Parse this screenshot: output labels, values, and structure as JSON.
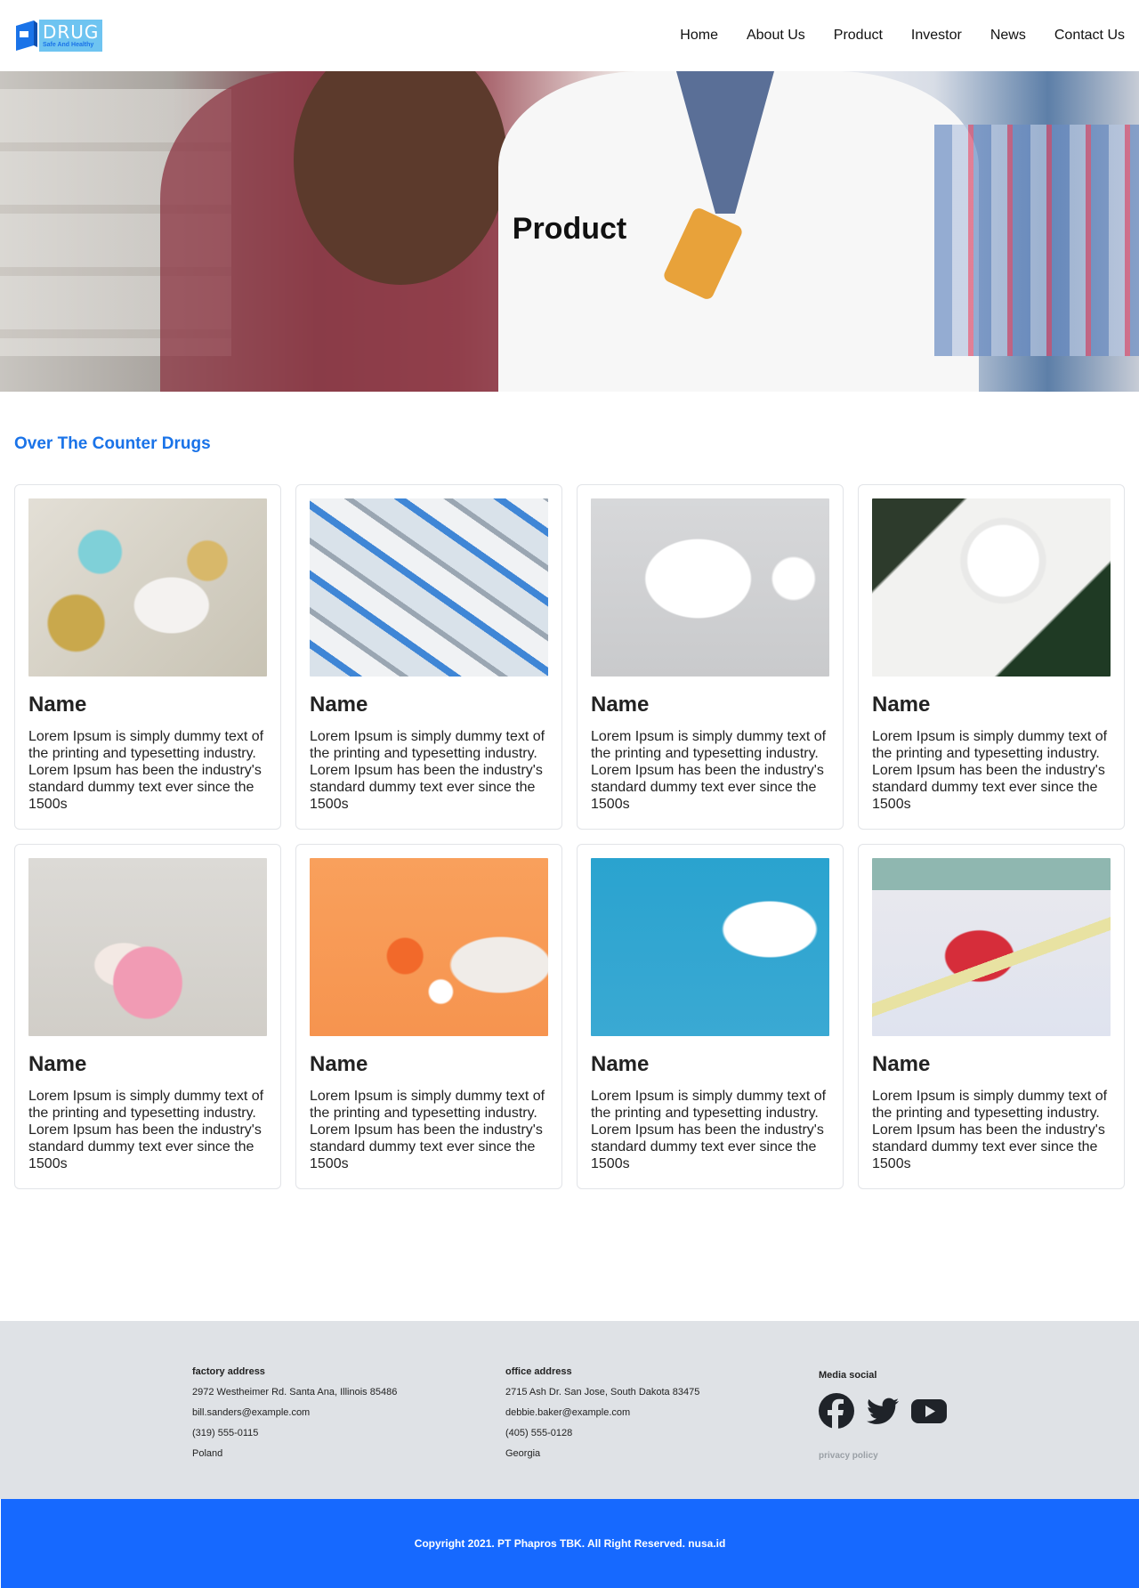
{
  "brand": {
    "name": "DRUG",
    "tagline": "Safe And Healthy"
  },
  "nav": [
    "Home",
    "About Us",
    "Product",
    "Investor",
    "News",
    "Contact Us"
  ],
  "hero": {
    "title": "Product"
  },
  "section": {
    "title": "Over The Counter Drugs"
  },
  "products": [
    {
      "name": "Name",
      "description": "Lorem Ipsum is simply dummy text of the printing and typesetting industry. Lorem Ipsum has been the industry's standard dummy text ever since the 1500s"
    },
    {
      "name": "Name",
      "description": "Lorem Ipsum is simply dummy text of the printing and typesetting industry. Lorem Ipsum has been the industry's standard dummy text ever since the 1500s"
    },
    {
      "name": "Name",
      "description": "Lorem Ipsum is simply dummy text of the printing and typesetting industry. Lorem Ipsum has been the industry's standard dummy text ever since the 1500s"
    },
    {
      "name": "Name",
      "description": "Lorem Ipsum is simply dummy text of the printing and typesetting industry. Lorem Ipsum has been the industry's standard dummy text ever since the 1500s"
    },
    {
      "name": "Name",
      "description": "Lorem Ipsum is simply dummy text of the printing and typesetting industry. Lorem Ipsum has been the industry's standard dummy text ever since the 1500s"
    },
    {
      "name": "Name",
      "description": "Lorem Ipsum is simply dummy text of the printing and typesetting industry. Lorem Ipsum has been the industry's standard dummy text ever since the 1500s"
    },
    {
      "name": "Name",
      "description": "Lorem Ipsum is simply dummy text of the printing and typesetting industry. Lorem Ipsum has been the industry's standard dummy text ever since the 1500s"
    },
    {
      "name": "Name",
      "description": "Lorem Ipsum is simply dummy text of the printing and typesetting industry. Lorem Ipsum has been the industry's standard dummy text ever since the 1500s"
    }
  ],
  "footer": {
    "factory": {
      "heading": "factory address",
      "address": "2972 Westheimer Rd. Santa Ana, Illinois 85486",
      "email": "bill.sanders@example.com",
      "phone": "(319) 555-0115",
      "country": "Poland"
    },
    "office": {
      "heading": "office address",
      "address": "2715 Ash Dr. San Jose, South Dakota 83475",
      "email": "debbie.baker@example.com",
      "phone": "(405) 555-0128",
      "country": "Georgia"
    },
    "social": {
      "heading": "Media social",
      "icons": [
        "facebook-icon",
        "twitter-icon",
        "youtube-icon"
      ],
      "privacy": "privacy policy"
    },
    "copyright": "Copyright 2021. PT Phapros TBK. All Right Reserved. nusa.id"
  },
  "colors": {
    "accent": "#1a73e8",
    "copyright_bg": "#1669ff",
    "footer_bg": "#dfe2e6",
    "logo_bg": "#6ec4f1"
  }
}
